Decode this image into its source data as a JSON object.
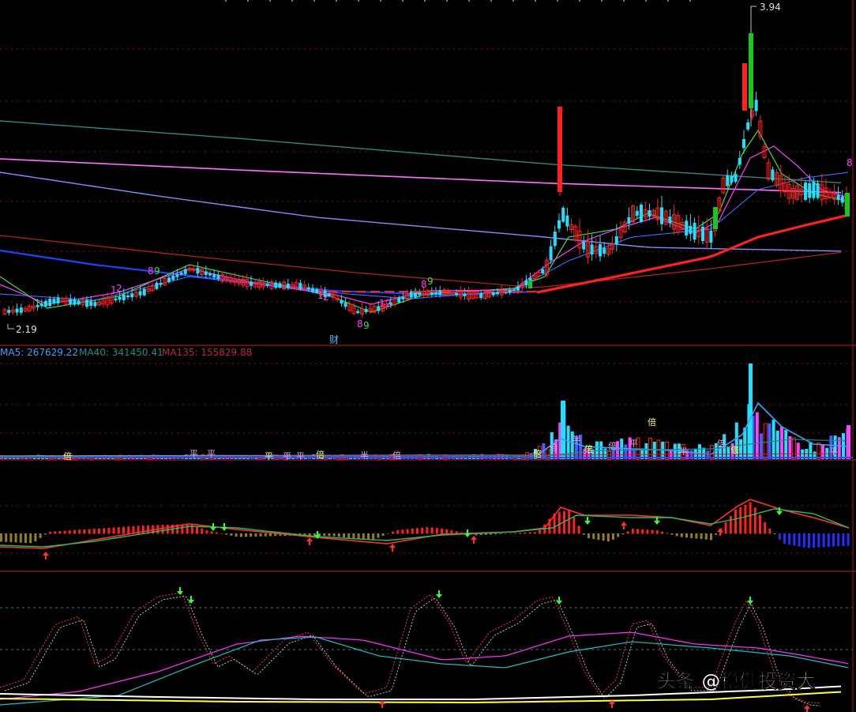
{
  "colors": {
    "up": "#ff2020",
    "down": "#20e0ff",
    "green": "#1cc41c",
    "grid": "#7a1010",
    "ma_price": [
      "#c0c0c0",
      "#ff40ff",
      "#40e040",
      "#4080ff",
      "#20a0a0",
      "#ff60ff",
      "#8080ff",
      "#c02020",
      "#2040ff",
      "#ff2020"
    ],
    "legend_ma5": "#3aa0ff",
    "legend_ma40": "#1a8a8a",
    "legend_ma135": "#c02040",
    "macd_dif": "#ff3030",
    "macd_dea": "#20c060",
    "kdj_dotted_a": "#ff3030",
    "kdj_dotted_b": "#c0c0c0",
    "osc_magenta": "#ff30ff",
    "osc_cyan": "#20c0c0",
    "osc_white": "#ffffff",
    "osc_yellow": "#ffff40"
  },
  "price_panel": {
    "high_label": "3.94",
    "low_label": "2.19",
    "finance_marker": "财",
    "count_marks": [
      "8",
      "9",
      "1",
      "2",
      "8",
      "9",
      "1",
      "2",
      "8",
      "9",
      "1",
      "2",
      "8",
      "9",
      "1"
    ]
  },
  "volume_panel": {
    "legend": {
      "ma5": "MA5: 267629.22",
      "ma40": "MA40: 341450.41",
      "ma135": "MA135: 155829.88"
    },
    "bar_tags": [
      "倍",
      "平",
      "平",
      "平",
      "平",
      "平",
      "倍",
      "半",
      "倍",
      "倍",
      "倍",
      "半",
      "倍",
      "倍",
      "平",
      "倍",
      "半",
      "倍",
      "倍",
      "平"
    ]
  },
  "watermark": "头条 @稳健投资大"
}
